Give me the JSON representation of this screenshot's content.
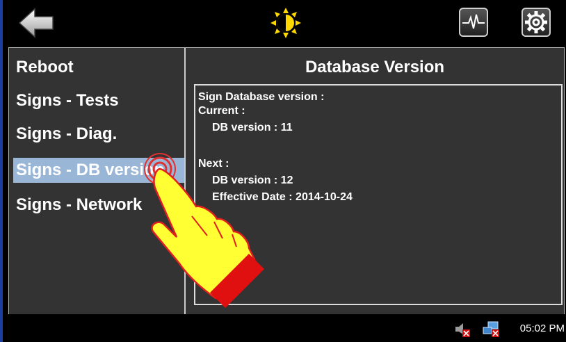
{
  "sidebar": {
    "items": [
      {
        "label": "Reboot"
      },
      {
        "label": "Signs - Tests"
      },
      {
        "label": "Signs - Diag."
      },
      {
        "label": "Signs - DB version"
      },
      {
        "label": "Signs - Network"
      }
    ],
    "selected_index": 3
  },
  "content": {
    "title": "Database Version",
    "lines": {
      "heading": "Sign Database version :",
      "current_label": "Current :",
      "current_db": "DB version :  11",
      "next_label": "Next :",
      "next_db": "DB version :  12",
      "effective": "Effective Date :  2014-10-24"
    }
  },
  "toolbar": {
    "icons": [
      "back-arrow-icon",
      "brightness-icon",
      "diagnostics-pulse-icon",
      "settings-gear-icon"
    ]
  },
  "taskbar": {
    "clock": "05:02 PM",
    "tray_icons": [
      "volume-muted-icon",
      "network-disconnected-icon"
    ]
  },
  "colors": {
    "background": "#000000",
    "panel": "#333333",
    "selected_item": "#9ab6d6",
    "brightness_icon": "#ffd800",
    "hand_fill": "#ffff33",
    "hand_cuff": "#e01010",
    "window_border": "#1a3fa0"
  }
}
